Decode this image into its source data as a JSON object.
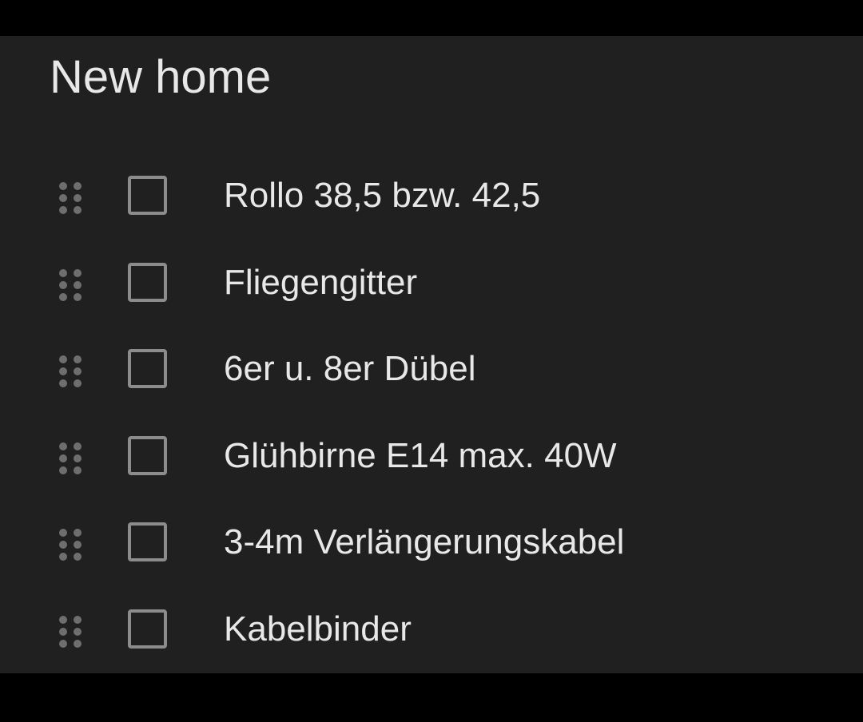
{
  "note": {
    "title": "New home",
    "items": [
      {
        "label": "Rollo 38,5 bzw. 42,5",
        "checked": false
      },
      {
        "label": "Fliegengitter",
        "checked": false
      },
      {
        "label": "6er u. 8er Dübel",
        "checked": false
      },
      {
        "label": "Glühbirne E14 max. 40W",
        "checked": false
      },
      {
        "label": "3-4m Verlängerungskabel",
        "checked": false
      },
      {
        "label": "Kabelbinder",
        "checked": false
      }
    ]
  },
  "icons": {
    "drag_handle": "drag-handle-icon",
    "checkbox": "checkbox-unchecked-icon"
  },
  "colors": {
    "background": "#202020",
    "text": "#e8e8e8",
    "checkbox_border": "#8c8c8c",
    "handle_dots": "#6e6e6e"
  }
}
